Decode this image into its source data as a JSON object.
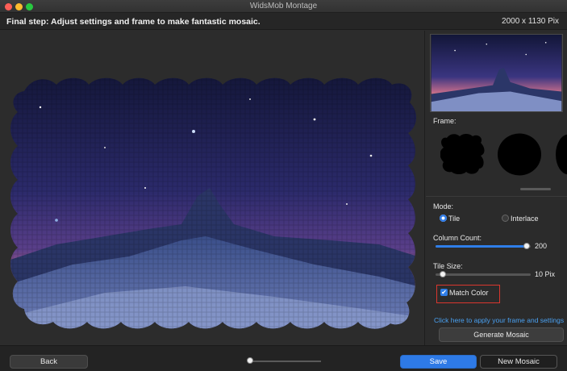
{
  "window": {
    "title": "WidsMob Montage",
    "traffic_colors": [
      "#ff5f57",
      "#febc2e",
      "#28c840"
    ]
  },
  "header": {
    "step_text": "Final step: Adjust settings and frame to make fantastic mosaic.",
    "dimensions": "2000 x 1130 Pix"
  },
  "sidebar": {
    "frame_label": "Frame:",
    "mode_label": "Mode:",
    "mode_options": [
      "Tile",
      "Interlace"
    ],
    "mode_selected": "Tile",
    "column_count_label": "Column Count:",
    "column_count_value": "200",
    "column_count_fraction": 0.95,
    "tile_size_label": "Tile Size:",
    "tile_size_value": "10 Pix",
    "tile_size_fraction": 0.0,
    "match_color_label": "Match Color",
    "match_color_checked": true,
    "apply_link": "Click here to apply your frame and settings",
    "generate_label": "Generate Mosaic"
  },
  "footer": {
    "back_label": "Back",
    "save_label": "Save",
    "new_mosaic_label": "New Mosaic",
    "zoom_fraction": 0.0
  },
  "colors": {
    "accent": "#2e7ae6",
    "link": "#4aa0f0",
    "highlight_border": "#d9372e"
  }
}
